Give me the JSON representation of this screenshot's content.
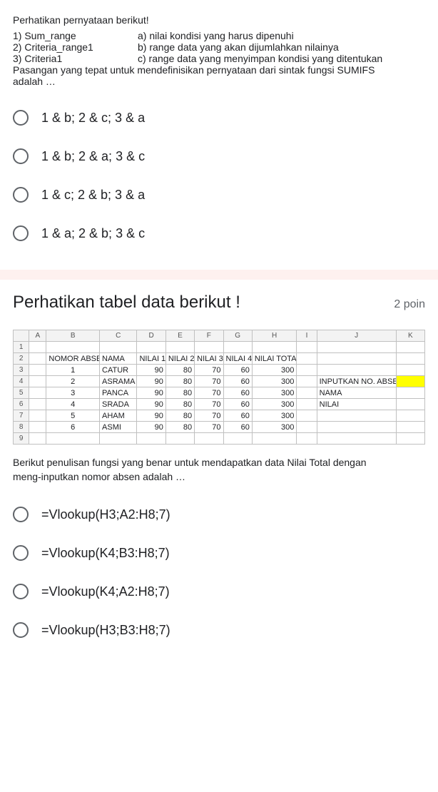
{
  "q1": {
    "intro": "Perhatikan pernyataan berikut!",
    "left1": "1) Sum_range",
    "right1": "a) nilai kondisi yang harus dipenuhi",
    "left2": "2) Criteria_range1",
    "right2": "b) range data yang akan dijumlahkan nilainya",
    "left3": "3) Criteria1",
    "right3": "c) range data yang menyimpan kondisi yang ditentukan",
    "tail1": "Pasangan yang tepat untuk mendefinisikan  pernyataan dari sintak fungsi SUMIFS",
    "tail2": "adalah …",
    "opts": [
      "1 & b; 2 & c; 3 & a",
      "1 & b; 2 & a; 3 & c",
      "1 & c; 2 & b; 3 & a",
      "1 & a; 2 & b; 3 & c"
    ]
  },
  "q2": {
    "title": "Perhatikan tabel data berikut !",
    "points": "2 poin",
    "cols": [
      "A",
      "B",
      "C",
      "D",
      "E",
      "F",
      "G",
      "H",
      "I",
      "J",
      "K"
    ],
    "headerRow": [
      "NOMOR ABSEN",
      "NAMA",
      "NILAI 1",
      "NILAI 2",
      "NILAI 3",
      "NILAI 4",
      "NILAI TOTAL"
    ],
    "rows": [
      {
        "n": "1",
        "nama": "CATUR",
        "v": [
          90,
          80,
          70,
          60
        ],
        "tot": 300
      },
      {
        "n": "2",
        "nama": "ASRAMA",
        "v": [
          90,
          80,
          70,
          60
        ],
        "tot": 300
      },
      {
        "n": "3",
        "nama": "PANCA",
        "v": [
          90,
          80,
          70,
          60
        ],
        "tot": 300
      },
      {
        "n": "4",
        "nama": "SRADA",
        "v": [
          90,
          80,
          70,
          60
        ],
        "tot": 300
      },
      {
        "n": "5",
        "nama": "AHAM",
        "v": [
          90,
          80,
          70,
          60
        ],
        "tot": 300
      },
      {
        "n": "6",
        "nama": "ASMI",
        "v": [
          90,
          80,
          70,
          60
        ],
        "tot": 300
      }
    ],
    "side": {
      "input": "INPUTKAN NO. ABSEN",
      "nama": "NAMA",
      "nilai": "NILAI"
    },
    "desc1": "Berikut penulisan fungsi yang benar untuk mendapatkan data Nilai Total dengan",
    "desc2": "meng-inputkan nomor absen adalah …",
    "opts": [
      "=Vlookup(H3;A2:H8;7)",
      "=Vlookup(K4;B3:H8;7)",
      "=Vlookup(K4;A2:H8;7)",
      "=Vlookup(H3;B3:H8;7)"
    ]
  }
}
